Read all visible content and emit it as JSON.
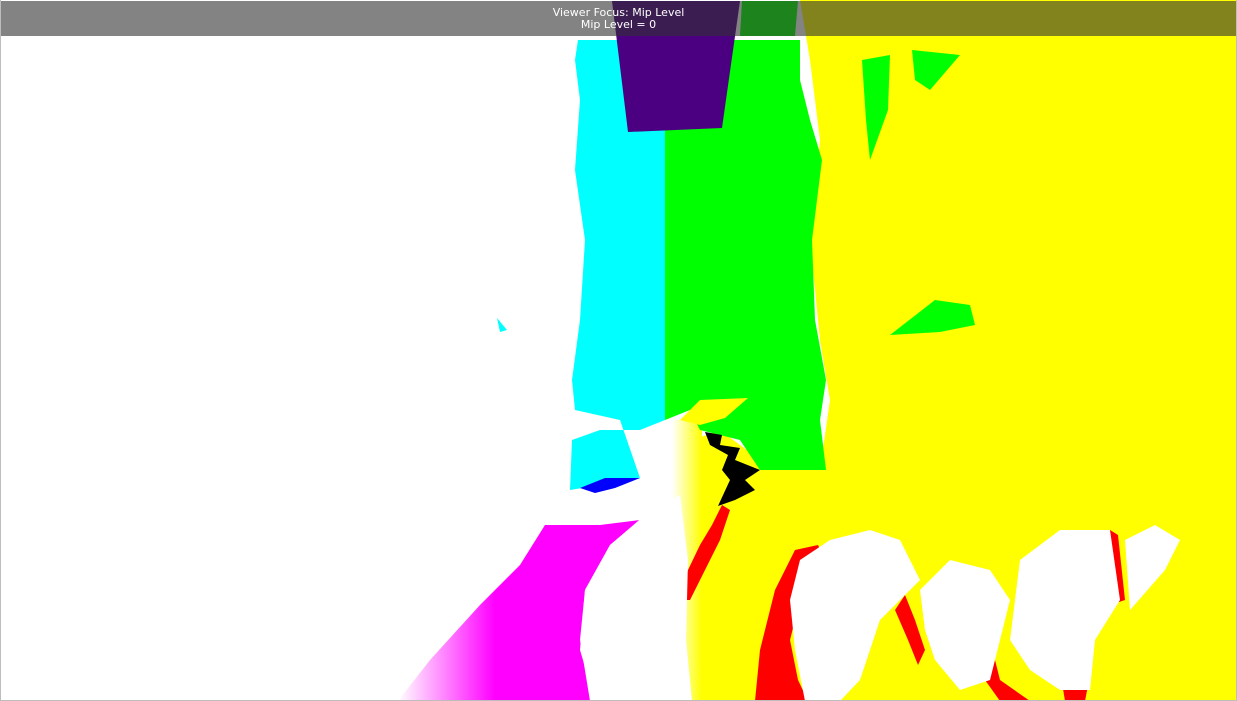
{
  "viewer": {
    "focus_label": "Viewer Focus: Mip Level",
    "mip_label": "Mip Level = 0"
  },
  "mip_colors": {
    "level_0": "#ffffff",
    "level_1": "#ffff00",
    "level_2": "#00ff00",
    "level_3": "#00ffff",
    "level_4": "#ff00ff",
    "level_5": "#ff0000",
    "level_6": "#0000ff",
    "level_7": "#4b0082",
    "other": "#000000"
  }
}
